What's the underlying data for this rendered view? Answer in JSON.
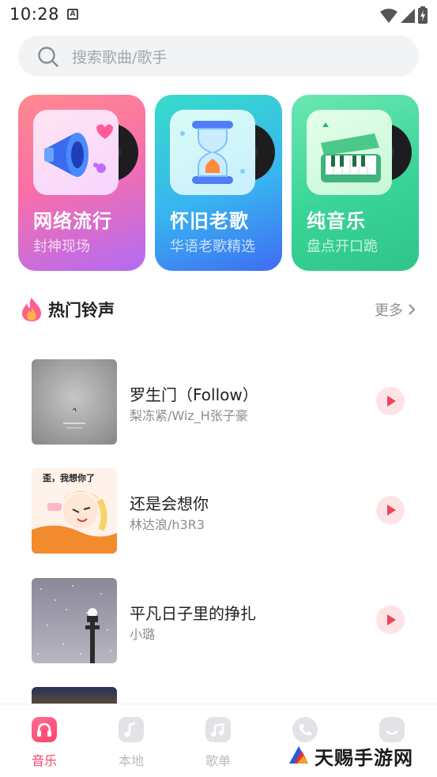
{
  "status_bar": {
    "time": "10:28",
    "notification_icon": "A"
  },
  "search": {
    "placeholder": "搜索歌曲/歌手"
  },
  "categories": [
    {
      "title": "网络流行",
      "subtitle": "封神现场",
      "icon": "megaphone-icon"
    },
    {
      "title": "怀旧老歌",
      "subtitle": "华语老歌精选",
      "icon": "hourglass-icon"
    },
    {
      "title": "纯音乐",
      "subtitle": "盘点开口跪",
      "icon": "piano-icon"
    }
  ],
  "section": {
    "title": "热门铃声",
    "more": "更多"
  },
  "songs": [
    {
      "title": "罗生门（Follow）",
      "artist": "梨冻紧/Wiz_H张子豪",
      "cover": "foggy-gray-cover"
    },
    {
      "title": "还是会想你",
      "artist": "林达浪/h3R3",
      "cover_text": "歪，我想你了"
    },
    {
      "title": "平凡日子里的挣扎",
      "artist": "小璐",
      "cover": "snowy-night-lamp-cover"
    }
  ],
  "bottom_nav": [
    {
      "label": "音乐",
      "active": true
    },
    {
      "label": "本地",
      "active": false
    },
    {
      "label": "歌单",
      "active": false
    },
    {
      "label": "",
      "active": false
    },
    {
      "label": "",
      "active": false
    }
  ],
  "watermark": {
    "text": "天赐手游网"
  },
  "colors": {
    "accent": "#ff3f6c",
    "play_icon": "#f0445a",
    "muted": "#8b8d92"
  }
}
